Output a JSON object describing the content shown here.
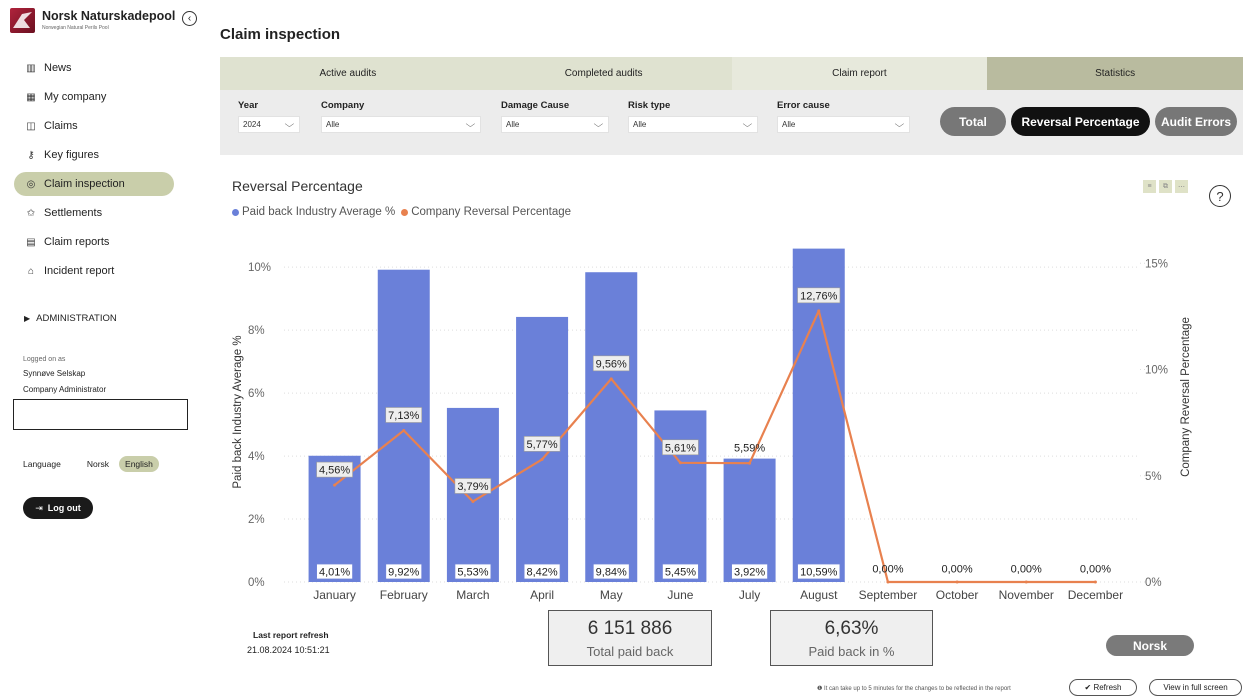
{
  "brand": {
    "name": "Norsk Naturskadepool",
    "subtitle": "Norwegian Natural Perils Pool",
    "collapse_icon": "‹"
  },
  "sidebar": {
    "items": [
      {
        "icon": "▥",
        "label": "News"
      },
      {
        "icon": "▦",
        "label": "My company"
      },
      {
        "icon": "◫",
        "label": "Claims"
      },
      {
        "icon": "⚷",
        "label": "Key figures"
      },
      {
        "icon": "◎",
        "label": "Claim inspection"
      },
      {
        "icon": "✩",
        "label": "Settlements"
      },
      {
        "icon": "▤",
        "label": "Claim reports"
      },
      {
        "icon": "⌂",
        "label": "Incident report"
      }
    ],
    "admin_label": "ADMINISTRATION",
    "logged_label": "Logged on as",
    "logged_user": "Synnøve Selskap",
    "logged_role": "Company Administrator",
    "language_label": "Language",
    "languages": [
      "Norsk",
      "English"
    ],
    "logout_label": "Log out"
  },
  "page": {
    "title": "Claim inspection"
  },
  "tabs": [
    "Active audits",
    "Completed audits",
    "Claim report",
    "Statistics"
  ],
  "filters": [
    {
      "label": "Year",
      "value": "2024"
    },
    {
      "label": "Company",
      "value": "Alle"
    },
    {
      "label": "Damage Cause",
      "value": "Alle"
    },
    {
      "label": "Risk type",
      "value": "Alle"
    },
    {
      "label": "Error cause",
      "value": "Alle"
    }
  ],
  "view_buttons": [
    "Total",
    "Reversal Percentage",
    "Audit Errors"
  ],
  "chart_data": {
    "type": "bar",
    "title": "Reversal Percentage",
    "categories": [
      "January",
      "February",
      "March",
      "April",
      "May",
      "June",
      "July",
      "August",
      "September",
      "October",
      "November",
      "December"
    ],
    "series": [
      {
        "name": "Paid back Industry Average %",
        "kind": "bar",
        "color": "#6a80d9",
        "values": [
          4.01,
          9.92,
          5.53,
          8.42,
          9.84,
          5.45,
          3.92,
          10.59,
          null,
          null,
          null,
          null
        ],
        "labels": [
          "4,01%",
          "9,92%",
          "5,53%",
          "8,42%",
          "9,84%",
          "5,45%",
          "3,92%",
          "10,59%",
          null,
          null,
          null,
          null
        ]
      },
      {
        "name": "Company Reversal Percentage",
        "kind": "line",
        "color": "#e8814f",
        "values": [
          4.56,
          7.13,
          3.79,
          5.77,
          9.56,
          5.61,
          5.59,
          12.76,
          0,
          0,
          0,
          0
        ],
        "labels": [
          "4,56%",
          "7,13%",
          "3,79%",
          "5,77%",
          "9,56%",
          "5,61%",
          "5,59%",
          "12,76%",
          "0,00%",
          "0,00%",
          "0,00%",
          "0,00%"
        ]
      }
    ],
    "ylabel": "Paid back Industry Average %",
    "y2label": "Company Reversal Percentage",
    "ylim": [
      0,
      10.8
    ],
    "yticks": [
      "0%",
      "2%",
      "4%",
      "6%",
      "8%",
      "10%"
    ],
    "y2lim": [
      0,
      16
    ],
    "y2ticks": [
      "0%",
      "5%",
      "10%",
      "15%"
    ],
    "grid": true,
    "legend": "top-left"
  },
  "vis_icons": [
    "≡",
    "⧉",
    "⋯"
  ],
  "help_icon": "?",
  "footer": {
    "refresh_label": "Last report refresh",
    "refresh_time": "21.08.2024 10:51:21",
    "kpi_total_value": "6 151 886",
    "kpi_total_label": "Total paid back",
    "kpi_pct_value": "6,63%",
    "kpi_pct_label": "Paid back in %",
    "norsk_button": "Norsk",
    "note": "❶ It can take up to 5 minutes for the changes to be reflected in the report",
    "refresh_button": "✔ Refresh",
    "fullscreen_button": "View in full screen"
  }
}
